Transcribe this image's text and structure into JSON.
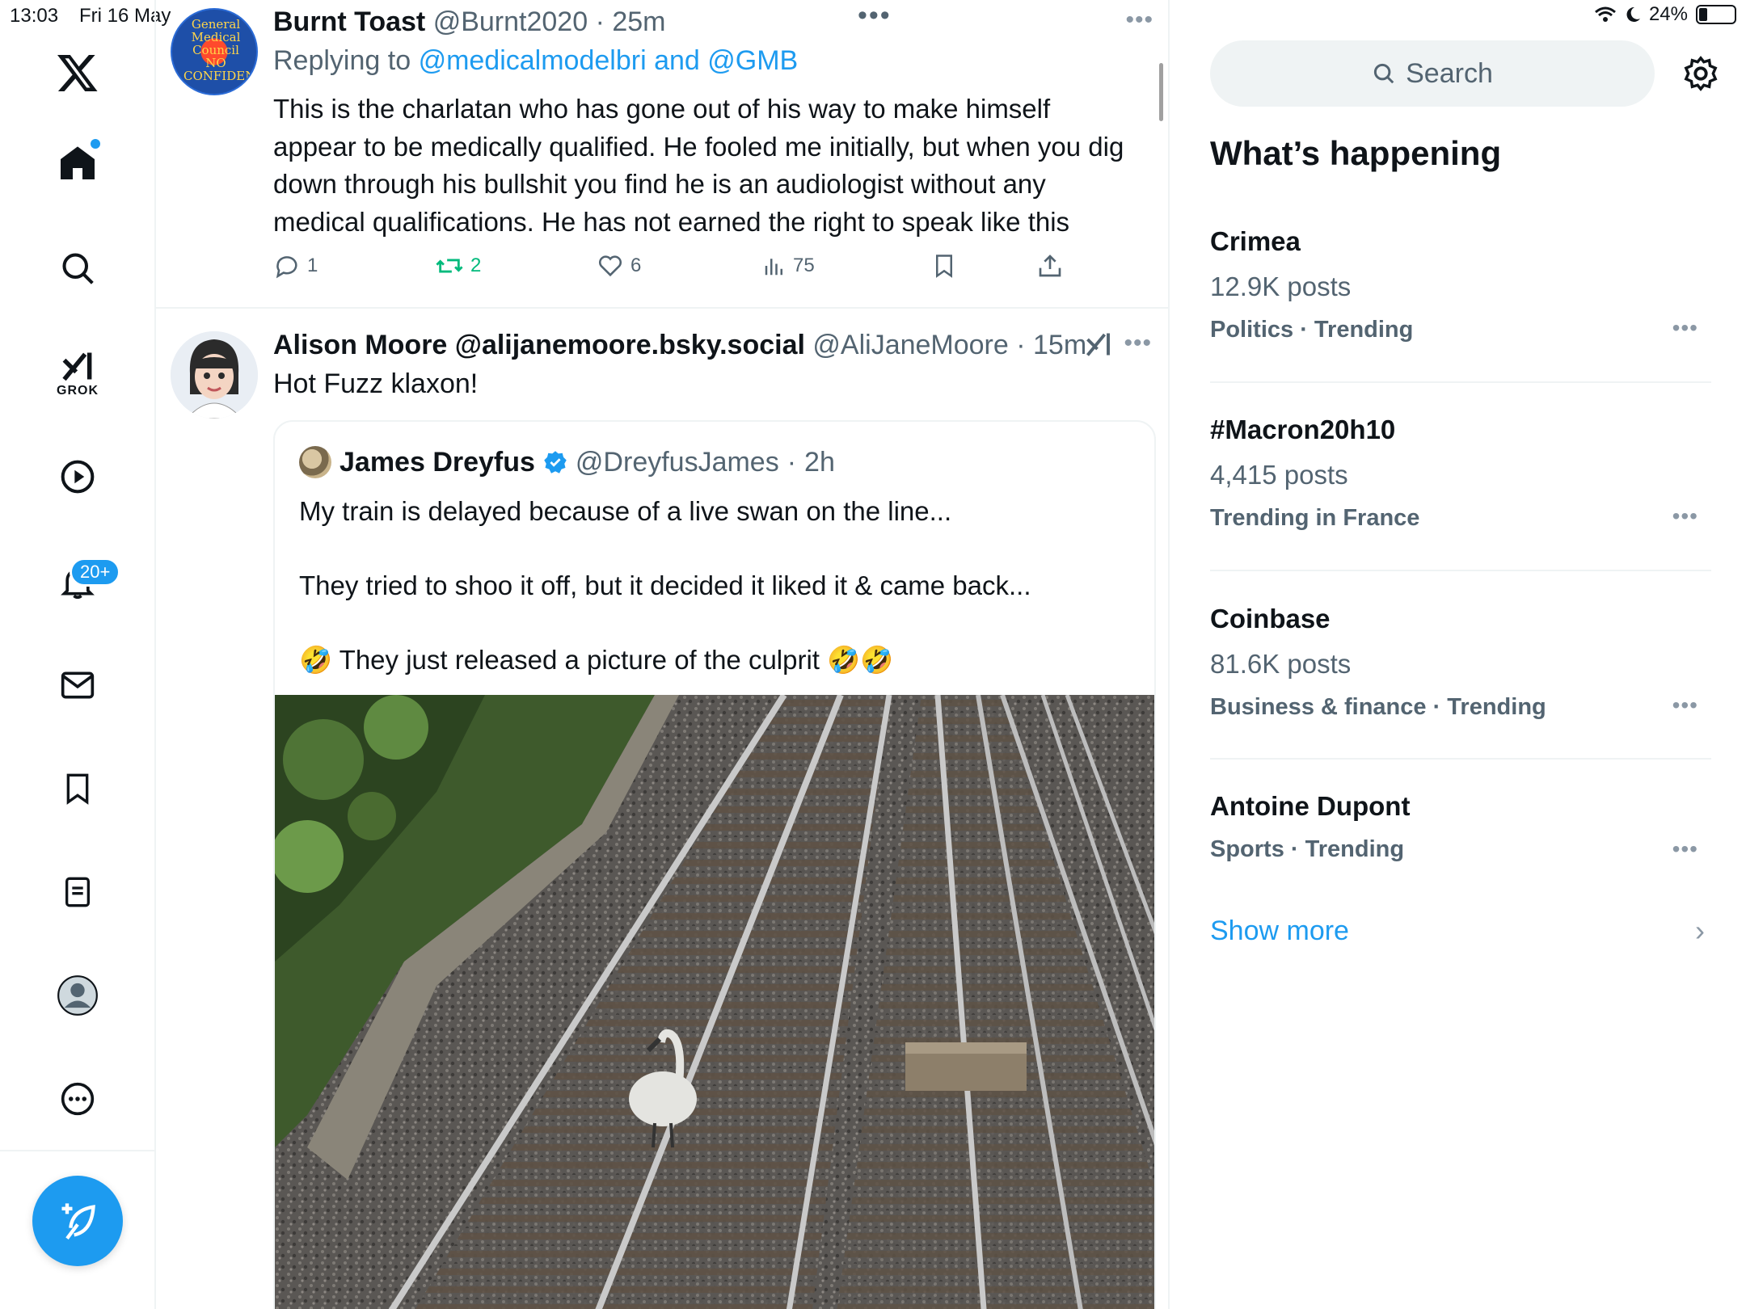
{
  "status": {
    "time": "13:03",
    "date": "Fri 16 May",
    "battery": "24%",
    "battery_level": 0.24
  },
  "nav": {
    "grok_label": "GROK",
    "notifications_badge": "20+"
  },
  "tweet1": {
    "avatar_text": "General Medical Council NO CONFIDENCE",
    "name": "Burnt Toast",
    "handle": "@Burnt2020",
    "time": "25m",
    "reply_prefix": "Replying to",
    "reply_to": "@medicalmodelbri and @GMB",
    "body": "This is the charlatan who has gone out of his way to make himself appear to be medically qualified. He fooled me initially, but when you dig down through his bullshit you find he is an audiologist without any medical qualifications. He has not earned the right to speak like this",
    "replies": "1",
    "retweets": "2",
    "likes": "6",
    "views": "75"
  },
  "tweet2": {
    "name": "Alison Moore @alijanemoore.bsky.social",
    "handle": "@AliJaneMoore",
    "time": "15m",
    "body": "Hot Fuzz klaxon!",
    "quote": {
      "name": "James Dreyfus",
      "handle": "@DreyfusJames",
      "time": "2h",
      "text": "My train is delayed because of a live swan on the line...\n\nThey tried to shoo it off, but it decided it liked it & came back...\n\n🤣 They just released a picture of the culprit 🤣🤣"
    }
  },
  "sidebar": {
    "search_placeholder": "Search",
    "title": "What’s happening",
    "trends": [
      {
        "topic": "Crimea",
        "count": "12.9K posts",
        "category": "Politics · Trending"
      },
      {
        "topic": "#Macron20h10",
        "count": "4,415 posts",
        "category": "Trending in France"
      },
      {
        "topic": "Coinbase",
        "count": "81.6K posts",
        "category": "Business & finance · Trending"
      },
      {
        "topic": "Antoine Dupont",
        "count": "",
        "category": "Sports · Trending"
      }
    ],
    "show_more": "Show more"
  },
  "colors": {
    "accent": "#1d9bf0",
    "retweet": "#00ba7c",
    "secondary_text": "#536471",
    "divider": "#eff3f4"
  }
}
